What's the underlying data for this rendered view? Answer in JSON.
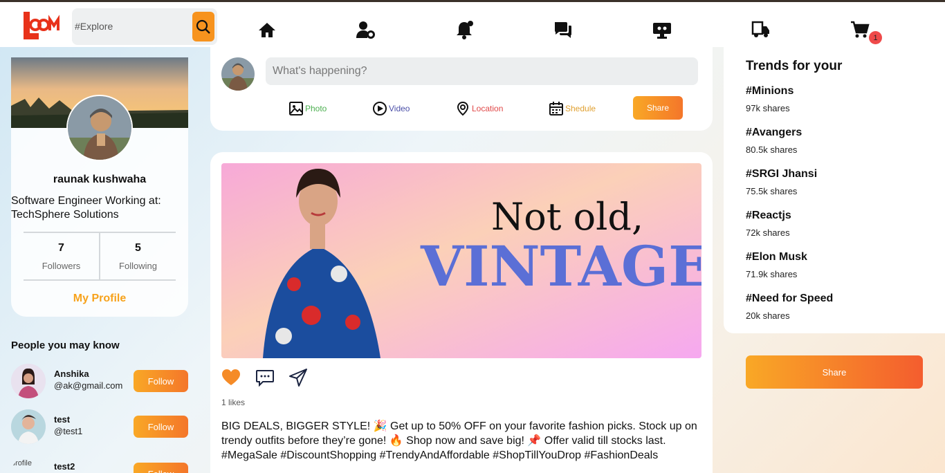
{
  "app": {
    "logo_text": "LOOM",
    "search": {
      "placeholder": "#Explore"
    },
    "nav_icons": [
      "home-icon",
      "user-settings-icon",
      "notification-bell-icon",
      "chat-icon",
      "monitor-icon",
      "delivery-truck-icon",
      "cart-icon"
    ],
    "cart_count": "1"
  },
  "profile": {
    "name": "raunak kushwaha",
    "bio": "Software Engineer Working at: TechSphere Solutions",
    "followers_count": "7",
    "followers_label": "Followers",
    "following_count": "5",
    "following_label": "Following",
    "link_label": "My Profile"
  },
  "people": {
    "title": "People you may know",
    "items": [
      {
        "name": "Anshika",
        "handle": "@ak@gmail.com",
        "button": "Follow"
      },
      {
        "name": "test",
        "handle": "@test1",
        "button": "Follow"
      },
      {
        "name": "test2",
        "alt": "profile",
        "button": "Follow"
      }
    ]
  },
  "composer": {
    "placeholder": "What's happening?",
    "options": [
      {
        "label": "Photo",
        "color": "#4caf50",
        "icon": "photo-icon"
      },
      {
        "label": "Video",
        "color": "#4b4fa8",
        "icon": "video-icon"
      },
      {
        "label": "Location",
        "color": "#e04848",
        "icon": "location-icon"
      },
      {
        "label": "Shedule",
        "color": "#e0a030",
        "icon": "calendar-icon"
      }
    ],
    "share_label": "Share"
  },
  "post": {
    "image_text_line1": "Not old,",
    "image_text_line2": "VINTAGE.",
    "likes": "1 likes",
    "caption": "BIG DEALS, BIGGER STYLE! 🎉 Get up to 50% OFF on your favorite fashion picks. Stock up on trendy outfits before they’re gone! 🔥 Shop now and save big! 📌 Offer valid till stocks last. #MegaSale #DiscountShopping #TrendyAndAffordable #ShopTillYouDrop #FashionDeals"
  },
  "trends": {
    "title": "Trends for your",
    "items": [
      {
        "tag": "#Minions",
        "shares": "97k shares"
      },
      {
        "tag": "#Avangers",
        "shares": "80.5k shares"
      },
      {
        "tag": "#SRGI Jhansi",
        "shares": "75.5k shares"
      },
      {
        "tag": "#Reactjs",
        "shares": "72k shares"
      },
      {
        "tag": "#Elon Musk",
        "shares": "71.9k shares"
      },
      {
        "tag": "#Need for Speed",
        "shares": "20k shares"
      }
    ]
  },
  "right_share_label": "Share",
  "colors": {
    "accent": "#f7931e",
    "accent_end": "#f45d2e",
    "link": "#f7a21b",
    "badge": "#ef4a4a"
  }
}
